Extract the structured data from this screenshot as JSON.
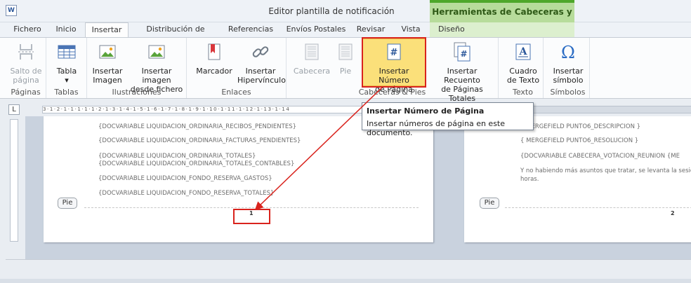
{
  "window": {
    "title": "Editor plantilla de notificación",
    "context_tab_title": "Herramientas de Cabeceras y Pies",
    "app_icon": "W"
  },
  "tabs": [
    {
      "label": "Fichero"
    },
    {
      "label": "Inicio"
    },
    {
      "label": "Insertar"
    },
    {
      "label": "Distribución de Página"
    },
    {
      "label": "Referencias"
    },
    {
      "label": "Envíos Postales"
    },
    {
      "label": "Revisar"
    },
    {
      "label": "Vista"
    },
    {
      "label": "Diseño"
    }
  ],
  "ribbon": {
    "groups": [
      {
        "label": "Páginas",
        "buttons": [
          {
            "label": "Salto de\npágina",
            "icon": "page-break-icon"
          }
        ]
      },
      {
        "label": "Tablas",
        "buttons": [
          {
            "label": "Tabla\n▾",
            "icon": "table-icon"
          }
        ]
      },
      {
        "label": "Ilustraciones",
        "buttons": [
          {
            "label": "Insertar\nImagen",
            "icon": "image-icon"
          },
          {
            "label": "Insertar imagen\ndesde fichero",
            "icon": "image-file-icon"
          }
        ]
      },
      {
        "label": "Enlaces",
        "buttons": [
          {
            "label": "Marcador",
            "icon": "bookmark-icon"
          },
          {
            "label": "Insertar\nHipervínculo",
            "icon": "hyperlink-icon"
          }
        ]
      },
      {
        "label": "Cabeceras & Pies",
        "buttons": [
          {
            "label": "Cabecera",
            "icon": "header-icon"
          },
          {
            "label": "Pie",
            "icon": "footer-icon"
          },
          {
            "label": "Insertar Número\nde Página",
            "icon": "page-number-icon"
          },
          {
            "label": "Insertar Recuento\nde Páginas Totales",
            "icon": "page-count-icon"
          }
        ]
      },
      {
        "label": "Texto",
        "buttons": [
          {
            "label": "Cuadro\nde Texto",
            "icon": "textbox-icon"
          }
        ]
      },
      {
        "label": "Símbolos",
        "buttons": [
          {
            "label": "Insertar\nsímbolo",
            "icon": "omega-icon"
          }
        ]
      }
    ]
  },
  "tooltip": {
    "title": "Insertar Número de Página",
    "body": "Insertar números de página en este documento."
  },
  "page1": {
    "fields": [
      "{DOCVARIABLE LIQUIDACION_ORDINARIA_RECIBOS_PENDIENTES}",
      "{DOCVARIABLE LIQUIDACION_ORDINARIA_FACTURAS_PENDIENTES}",
      "{DOCVARIABLE LIQUIDACION_ORDINARIA_TOTALES}",
      "{DOCVARIABLE LIQUIDACION_ORDINARIA_TOTALES_CONTABLES}",
      "{DOCVARIABLE LIQUIDACION_FONDO_RESERVA_GASTOS}",
      "{DOCVARIABLE LIQUIDACION_FONDO_RESERVA_TOTALES}"
    ],
    "footer_tag": "Pie",
    "page_number": "1"
  },
  "page2": {
    "fields": [
      "{ MERGEFIELD PUNTO6_DESCRIPCION }",
      "{ MERGEFIELD PUNTO6_RESOLUCION }",
      "{DOCVARIABLE CABECERA_VOTACION_REUNION {ME",
      "Y no habiendo más asuntos que tratar, se levanta la sesión",
      "horas."
    ],
    "footer_tag": "Pie",
    "page_number": "2"
  },
  "ruler": {
    "corner": "L",
    "ticks": "3·1·2·1·1·1·1·1·2·1·3·1·4·1·5·1·6·1·7·1·8·1·9·1·10·1·11·1·12·1·13·1·14"
  },
  "colors": {
    "accent_red": "#d9231d",
    "context_green": "#4ea72a",
    "highlight_yellow": "#fbe07a"
  }
}
